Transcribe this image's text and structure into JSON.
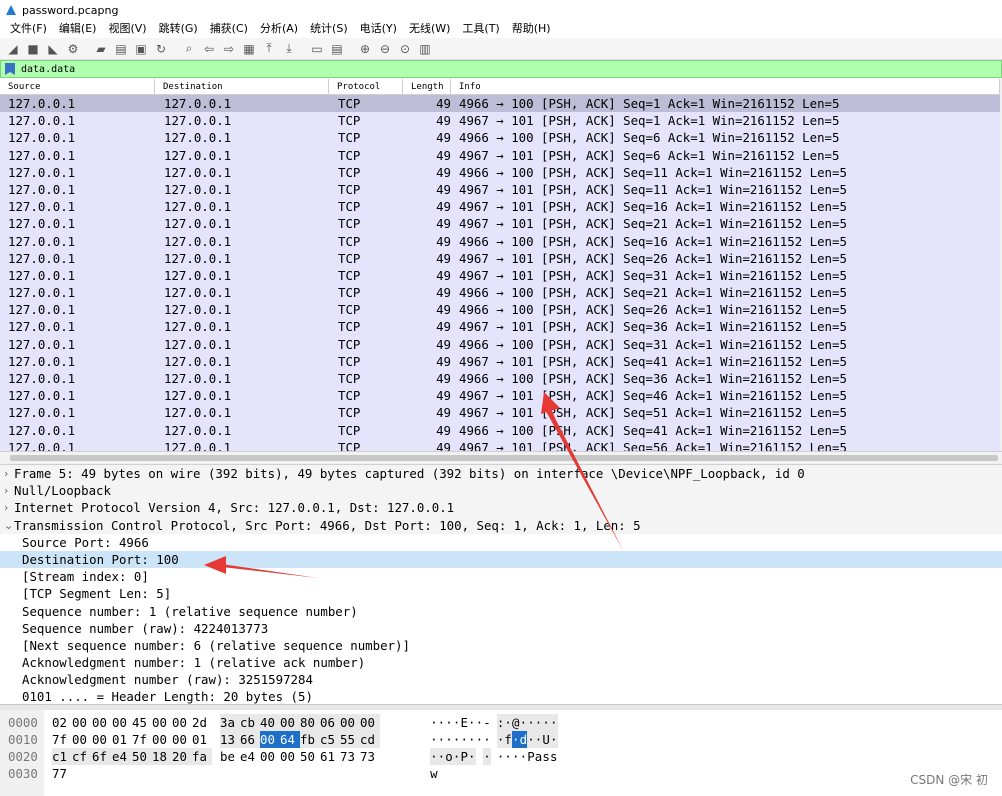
{
  "window": {
    "title": "password.pcapng"
  },
  "menu": [
    "文件(F)",
    "编辑(E)",
    "视图(V)",
    "跳转(G)",
    "捕获(C)",
    "分析(A)",
    "统计(S)",
    "电话(Y)",
    "无线(W)",
    "工具(T)",
    "帮助(H)"
  ],
  "toolbar": {
    "icons": [
      "shark-fin-start-icon",
      "stop-square-icon",
      "shark-fin-restart-icon",
      "capture-options-icon",
      "open-folder-icon",
      "save-file-icon",
      "close-file-icon",
      "reload-file-icon",
      "find-packet-icon",
      "go-back-icon",
      "go-forward-icon",
      "go-to-packet-icon",
      "go-first-icon",
      "go-last-icon",
      "autoscroll-icon",
      "colorize-icon",
      "zoom-in-icon",
      "zoom-out-icon",
      "zoom-normal-icon",
      "resize-columns-icon"
    ]
  },
  "filter": {
    "value": "data.data"
  },
  "packet_list": {
    "columns": [
      "Source",
      "Destination",
      "Protocol",
      "Length",
      "Info"
    ],
    "rows": [
      {
        "src": "127.0.0.1",
        "dst": "127.0.0.1",
        "proto": "TCP",
        "len": "49",
        "info": "4966 → 100 [PSH, ACK] Seq=1 Ack=1 Win=2161152 Len=5"
      },
      {
        "src": "127.0.0.1",
        "dst": "127.0.0.1",
        "proto": "TCP",
        "len": "49",
        "info": "4967 → 101 [PSH, ACK] Seq=1 Ack=1 Win=2161152 Len=5"
      },
      {
        "src": "127.0.0.1",
        "dst": "127.0.0.1",
        "proto": "TCP",
        "len": "49",
        "info": "4966 → 100 [PSH, ACK] Seq=6 Ack=1 Win=2161152 Len=5"
      },
      {
        "src": "127.0.0.1",
        "dst": "127.0.0.1",
        "proto": "TCP",
        "len": "49",
        "info": "4967 → 101 [PSH, ACK] Seq=6 Ack=1 Win=2161152 Len=5"
      },
      {
        "src": "127.0.0.1",
        "dst": "127.0.0.1",
        "proto": "TCP",
        "len": "49",
        "info": "4966 → 100 [PSH, ACK] Seq=11 Ack=1 Win=2161152 Len=5"
      },
      {
        "src": "127.0.0.1",
        "dst": "127.0.0.1",
        "proto": "TCP",
        "len": "49",
        "info": "4967 → 101 [PSH, ACK] Seq=11 Ack=1 Win=2161152 Len=5"
      },
      {
        "src": "127.0.0.1",
        "dst": "127.0.0.1",
        "proto": "TCP",
        "len": "49",
        "info": "4967 → 101 [PSH, ACK] Seq=16 Ack=1 Win=2161152 Len=5"
      },
      {
        "src": "127.0.0.1",
        "dst": "127.0.0.1",
        "proto": "TCP",
        "len": "49",
        "info": "4967 → 101 [PSH, ACK] Seq=21 Ack=1 Win=2161152 Len=5"
      },
      {
        "src": "127.0.0.1",
        "dst": "127.0.0.1",
        "proto": "TCP",
        "len": "49",
        "info": "4966 → 100 [PSH, ACK] Seq=16 Ack=1 Win=2161152 Len=5"
      },
      {
        "src": "127.0.0.1",
        "dst": "127.0.0.1",
        "proto": "TCP",
        "len": "49",
        "info": "4967 → 101 [PSH, ACK] Seq=26 Ack=1 Win=2161152 Len=5"
      },
      {
        "src": "127.0.0.1",
        "dst": "127.0.0.1",
        "proto": "TCP",
        "len": "49",
        "info": "4967 → 101 [PSH, ACK] Seq=31 Ack=1 Win=2161152 Len=5"
      },
      {
        "src": "127.0.0.1",
        "dst": "127.0.0.1",
        "proto": "TCP",
        "len": "49",
        "info": "4966 → 100 [PSH, ACK] Seq=21 Ack=1 Win=2161152 Len=5"
      },
      {
        "src": "127.0.0.1",
        "dst": "127.0.0.1",
        "proto": "TCP",
        "len": "49",
        "info": "4966 → 100 [PSH, ACK] Seq=26 Ack=1 Win=2161152 Len=5"
      },
      {
        "src": "127.0.0.1",
        "dst": "127.0.0.1",
        "proto": "TCP",
        "len": "49",
        "info": "4967 → 101 [PSH, ACK] Seq=36 Ack=1 Win=2161152 Len=5"
      },
      {
        "src": "127.0.0.1",
        "dst": "127.0.0.1",
        "proto": "TCP",
        "len": "49",
        "info": "4966 → 100 [PSH, ACK] Seq=31 Ack=1 Win=2161152 Len=5"
      },
      {
        "src": "127.0.0.1",
        "dst": "127.0.0.1",
        "proto": "TCP",
        "len": "49",
        "info": "4967 → 101 [PSH, ACK] Seq=41 Ack=1 Win=2161152 Len=5"
      },
      {
        "src": "127.0.0.1",
        "dst": "127.0.0.1",
        "proto": "TCP",
        "len": "49",
        "info": "4966 → 100 [PSH, ACK] Seq=36 Ack=1 Win=2161152 Len=5"
      },
      {
        "src": "127.0.0.1",
        "dst": "127.0.0.1",
        "proto": "TCP",
        "len": "49",
        "info": "4967 → 101 [PSH, ACK] Seq=46 Ack=1 Win=2161152 Len=5"
      },
      {
        "src": "127.0.0.1",
        "dst": "127.0.0.1",
        "proto": "TCP",
        "len": "49",
        "info": "4967 → 101 [PSH, ACK] Seq=51 Ack=1 Win=2161152 Len=5"
      },
      {
        "src": "127.0.0.1",
        "dst": "127.0.0.1",
        "proto": "TCP",
        "len": "49",
        "info": "4966 → 100 [PSH, ACK] Seq=41 Ack=1 Win=2161152 Len=5"
      },
      {
        "src": "127.0.0.1",
        "dst": "127.0.0.1",
        "proto": "TCP",
        "len": "49",
        "info": "4967 → 101 [PSH, ACK] Seq=56 Ack=1 Win=2161152 Len=5"
      }
    ]
  },
  "details": {
    "top": [
      {
        "arrow": ">",
        "text": "Frame 5: 49 bytes on wire (392 bits), 49 bytes captured (392 bits) on interface \\Device\\NPF_Loopback, id 0"
      },
      {
        "arrow": ">",
        "text": "Null/Loopback"
      },
      {
        "arrow": ">",
        "text": "Internet Protocol Version 4, Src: 127.0.0.1, Dst: 127.0.0.1"
      },
      {
        "arrow": "v",
        "text": "Transmission Control Protocol, Src Port: 4966, Dst Port: 100, Seq: 1, Ack: 1, Len: 5"
      }
    ],
    "children": [
      "Source Port: 4966",
      "Destination Port: 100",
      "[Stream index: 0]",
      "[TCP Segment Len: 5]",
      "Sequence number: 1    (relative sequence number)",
      "Sequence number (raw): 4224013773",
      "[Next sequence number: 6    (relative sequence number)]",
      "Acknowledgment number: 1    (relative ack number)",
      "Acknowledgment number (raw): 3251597284",
      "0101 .... = Header Length: 20 bytes (5)"
    ]
  },
  "bytes": {
    "rows": [
      {
        "offset": "0000",
        "hex": [
          "02",
          "00",
          "00",
          "00",
          "45",
          "00",
          "00",
          "2d",
          "3a",
          "cb",
          "40",
          "00",
          "80",
          "06",
          "00",
          "00"
        ],
        "ascii": [
          "·",
          "·",
          "·",
          "·",
          "E",
          "·",
          "·",
          "-",
          ":",
          "·",
          "@",
          "·",
          "·",
          "·",
          "·",
          "·"
        ]
      },
      {
        "offset": "0010",
        "hex": [
          "7f",
          "00",
          "00",
          "01",
          "7f",
          "00",
          "00",
          "01",
          "13",
          "66",
          "00",
          "64",
          "fb",
          "c5",
          "55",
          "cd"
        ],
        "ascii": [
          "·",
          "·",
          "·",
          "·",
          "·",
          "·",
          "·",
          "·",
          "·",
          "f",
          "·",
          "d",
          "·",
          "·",
          "U",
          "·"
        ]
      },
      {
        "offset": "0020",
        "hex": [
          "c1",
          "cf",
          "6f",
          "e4",
          "50",
          "18",
          "20",
          "fa",
          "be",
          "e4",
          "00",
          "00",
          "50",
          "61",
          "73",
          "73"
        ],
        "ascii": [
          "·",
          "·",
          "o",
          "·",
          "P",
          "·",
          " ",
          "·",
          "·",
          "·",
          "·",
          "·",
          "P",
          "a",
          "s",
          "s"
        ]
      },
      {
        "offset": "0030",
        "hex": [
          "77"
        ],
        "ascii": [
          "w"
        ]
      }
    ]
  },
  "watermark": "CSDN @宋 初",
  "colors": {
    "filter_bg": "#afffaf",
    "row_bg": "#e4e4fc",
    "selected_row": "#bdbdd8",
    "highlight_field": "#cce4f8",
    "byte_highlight": "#1e6fc9",
    "annotation_arrow": "#e53935"
  }
}
